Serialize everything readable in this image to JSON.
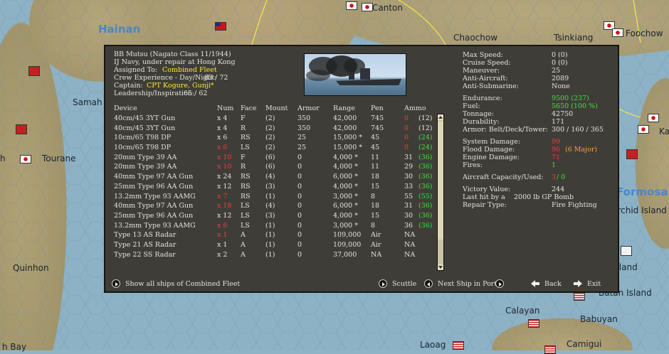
{
  "map": {
    "labels": {
      "hainan": "Hainan",
      "canton": "Canton",
      "chaochow": "Chaochow",
      "tsinkiang": "Tsinkiang",
      "foochow": "Foochow",
      "samah": "Samah",
      "tourane": "Tourane",
      "quinhon": "Quinhon",
      "hinh_bay": "h Bay",
      "ka": "Ka",
      "formosa": "Formosa",
      "orchid_island": "Orchid Island",
      "island": "Island",
      "batan_island": "Batan Island",
      "calayan": "Calayan",
      "babuyan": "Babuyan",
      "laoag": "Laoag",
      "camigui": "Camigui",
      "h": "h"
    }
  },
  "ship": {
    "name_line": "BB Mutsu (Nagato Class 11/1944)",
    "status_line": "IJ Navy, under repair at Hong Kong",
    "assigned_label": "Assigned To:",
    "assigned_value": "Combined Fleet",
    "crew_label": "Crew Experience - Day/Night:",
    "crew_value": "83 / 72",
    "captain_label": "Captain:",
    "captain_value": "CPT Kogure, Gunji*",
    "leadership_label": "Leadership/Inspiration:",
    "leadership_value": "65 / 62"
  },
  "stats": [
    {
      "label": "Max Speed:",
      "value": "0 (0)",
      "color": "normal"
    },
    {
      "label": "Cruise Speed:",
      "value": "0 (0)",
      "color": "normal"
    },
    {
      "label": "Maneuver:",
      "value": "25",
      "color": "normal"
    },
    {
      "label": "Anti-Aircraft:",
      "value": "2089",
      "color": "normal"
    },
    {
      "label": "Anti-Submarine:",
      "value": "None",
      "color": "normal"
    },
    {
      "label": "Endurance:",
      "value": "9500 (237)",
      "color": "green"
    },
    {
      "label": "Fuel:",
      "value": "5650 (100 %)",
      "color": "green"
    },
    {
      "label": "Tonnage:",
      "value": "42750",
      "color": "normal"
    },
    {
      "label": "Durability:",
      "value": "171",
      "color": "normal"
    },
    {
      "label": "Armor: Belt/Deck/Tower:",
      "value": "300 / 160 / 365",
      "color": "normal"
    },
    {
      "label": "System Damage:",
      "value": "99",
      "color": "red"
    },
    {
      "label": "Flood Damage:",
      "value": "96",
      "color": "red",
      "extra": "(6 Major)"
    },
    {
      "label": "Engine Damage:",
      "value": "71",
      "color": "red"
    },
    {
      "label": "Fires:",
      "value": "1",
      "color": "green"
    },
    {
      "label": "Aircraft Capacity/Used:",
      "value": "3",
      "value2": "/ 0",
      "color": "red"
    },
    {
      "label": "Victory Value:",
      "value": "244",
      "color": "normal"
    },
    {
      "label": "Last hit by a",
      "value": "2000 lb GP Bomb",
      "color": "normal"
    },
    {
      "label": "Repair Type:",
      "value": "Fire Fighting",
      "color": "normal"
    }
  ],
  "devices": {
    "headers": [
      "Device",
      "Num",
      "Face",
      "Mount",
      "Armor",
      "Range",
      "Pen",
      "Ammo"
    ],
    "rows": [
      {
        "device": "40cm/45 3YT Gun",
        "num": "x 4",
        "num_red": false,
        "face": "F",
        "mount": "(2)",
        "armor": "350",
        "range": "42,000",
        "pen": "745",
        "ammo": "0",
        "ammo_max": "(12)",
        "ammo_red": true,
        "max_green": false
      },
      {
        "device": "40cm/45 3YT Gun",
        "num": "x 4",
        "num_red": false,
        "face": "R",
        "mount": "(2)",
        "armor": "350",
        "range": "42,000",
        "pen": "745",
        "ammo": "0",
        "ammo_max": "(12)",
        "ammo_red": true,
        "max_green": false
      },
      {
        "device": "10cm/65 T98 DP",
        "num": "x 6",
        "num_red": false,
        "face": "RS",
        "mount": "(2)",
        "armor": "25",
        "range": "15,000 *",
        "pen": "45",
        "ammo": "0",
        "ammo_max": "(24)",
        "ammo_red": true,
        "max_green": true
      },
      {
        "device": "10cm/65 T98 DP",
        "num": "x 6",
        "num_red": true,
        "face": "LS",
        "mount": "(2)",
        "armor": "25",
        "range": "15,000 *",
        "pen": "45",
        "ammo": "0",
        "ammo_max": "(24)",
        "ammo_red": true,
        "max_green": true
      },
      {
        "device": "20mm Type 39 AA",
        "num": "x 10",
        "num_red": true,
        "face": "F",
        "mount": "(6)",
        "armor": "0",
        "range": "4,000 *",
        "pen": "11",
        "ammo": "31",
        "ammo_max": "(36)",
        "ammo_red": false,
        "max_green": true
      },
      {
        "device": "20mm Type 39 AA",
        "num": "x 10",
        "num_red": true,
        "face": "R",
        "mount": "(6)",
        "armor": "0",
        "range": "4,000 *",
        "pen": "11",
        "ammo": "29",
        "ammo_max": "(36)",
        "ammo_red": false,
        "max_green": true
      },
      {
        "device": "40mm Type 97 AA Gun",
        "num": "x 24",
        "num_red": false,
        "face": "RS",
        "mount": "(4)",
        "armor": "0",
        "range": "6,000 *",
        "pen": "18",
        "ammo": "30",
        "ammo_max": "(36)",
        "ammo_red": false,
        "max_green": true
      },
      {
        "device": "25mm Type 96 AA Gun",
        "num": "x 12",
        "num_red": false,
        "face": "RS",
        "mount": "(3)",
        "armor": "0",
        "range": "4,000 *",
        "pen": "15",
        "ammo": "33",
        "ammo_max": "(36)",
        "ammo_red": false,
        "max_green": true
      },
      {
        "device": "13.2mm Type 93 AAMG",
        "num": "x 7",
        "num_red": true,
        "face": "RS",
        "mount": "(1)",
        "armor": "0",
        "range": "3,000 *",
        "pen": "8",
        "ammo": "55",
        "ammo_max": "(55)",
        "ammo_red": false,
        "max_green": true
      },
      {
        "device": "40mm Type 97 AA Gun",
        "num": "x 18",
        "num_red": true,
        "face": "LS",
        "mount": "(4)",
        "armor": "0",
        "range": "6,000 *",
        "pen": "18",
        "ammo": "31",
        "ammo_max": "(36)",
        "ammo_red": false,
        "max_green": true
      },
      {
        "device": "25mm Type 96 AA Gun",
        "num": "x 12",
        "num_red": false,
        "face": "LS",
        "mount": "(3)",
        "armor": "0",
        "range": "4,000 *",
        "pen": "15",
        "ammo": "30",
        "ammo_max": "(36)",
        "ammo_red": false,
        "max_green": true
      },
      {
        "device": "13.2mm Type 93 AAMG",
        "num": "x 6",
        "num_red": true,
        "face": "LS",
        "mount": "(1)",
        "armor": "0",
        "range": "3,000 *",
        "pen": "8",
        "ammo": "36",
        "ammo_max": "(36)",
        "ammo_red": false,
        "max_green": true
      },
      {
        "device": "Type 13 AS Radar",
        "num": "x 1",
        "num_red": true,
        "face": "A",
        "mount": "(1)",
        "armor": "0",
        "range": "109,000",
        "pen": "Air",
        "ammo": "NA",
        "ammo_max": "",
        "ammo_red": false,
        "max_green": false
      },
      {
        "device": "Type 21 AS Radar",
        "num": "x 1",
        "num_red": false,
        "face": "A",
        "mount": "(1)",
        "armor": "0",
        "range": "109,000",
        "pen": "Air",
        "ammo": "NA",
        "ammo_max": "",
        "ammo_red": false,
        "max_green": false
      },
      {
        "device": "Type 22 SS Radar",
        "num": "x 2",
        "num_red": false,
        "face": "A",
        "mount": "(1)",
        "armor": "0",
        "range": "37,000",
        "pen": "NA",
        "ammo": "NA",
        "ammo_max": "",
        "ammo_red": false,
        "max_green": false
      }
    ]
  },
  "footer": {
    "show_all": "Show all ships of Combined Fleet",
    "scuttle": "Scuttle",
    "next_ship": "Next Ship in Port",
    "back": "Back",
    "exit": "Exit"
  },
  "colors": {
    "panel": "#3f3d38",
    "yellow": "#ffe83a",
    "green": "#3ce23c",
    "red": "#f23a3a",
    "orange": "#ff9c3a"
  }
}
